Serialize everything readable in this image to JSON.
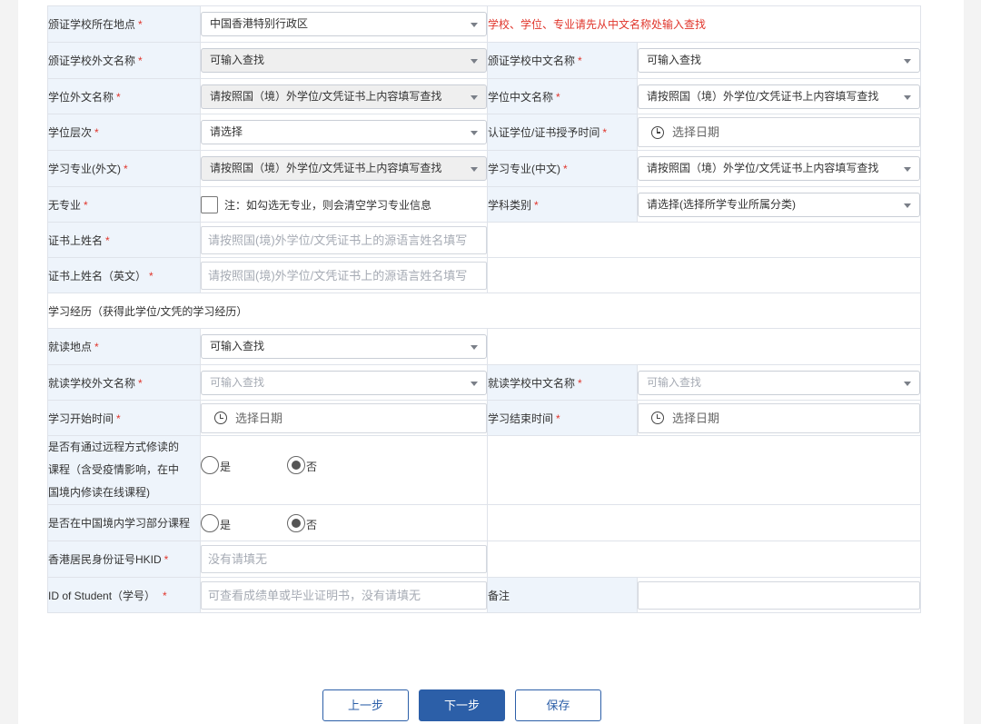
{
  "rows": {
    "school_location": {
      "label": "颁证学校所在地点",
      "value": "中国香港特别行政区",
      "note": "学校、学位、专业请先从中文名称处输入查找"
    },
    "school_foreign": {
      "label": "颁证学校外文名称",
      "value": "可输入查找"
    },
    "school_cn": {
      "label": "颁证学校中文名称",
      "value": "可输入查找"
    },
    "degree_foreign": {
      "label": "学位外文名称",
      "value": "请按照国（境）外学位/文凭证书上内容填写查找"
    },
    "degree_cn": {
      "label": "学位中文名称",
      "value": "请按照国（境）外学位/文凭证书上内容填写查找"
    },
    "degree_level": {
      "label": "学位层次",
      "value": "请选择"
    },
    "award_time": {
      "label": "认证学位/证书授予时间",
      "value": "选择日期"
    },
    "major_foreign": {
      "label": "学习专业(外文)",
      "value": "请按照国（境）外学位/文凭证书上内容填写查找"
    },
    "major_cn": {
      "label": "学习专业(中文)",
      "value": "请按照国（境）外学位/文凭证书上内容填写查找"
    },
    "no_major": {
      "label": "无专业",
      "checkbox_text": "注：如勾选无专业，则会清空学习专业信息"
    },
    "subject_category": {
      "label": "学科类别",
      "value": "请选择(选择所学专业所属分类)"
    },
    "cert_name": {
      "label": "证书上姓名",
      "placeholder": "请按照国(境)外学位/文凭证书上的源语言姓名填写"
    },
    "cert_name_en": {
      "label": "证书上姓名（英文）",
      "placeholder": "请按照国(境)外学位/文凭证书上的源语言姓名填写"
    },
    "study_section": {
      "label": "学习经历（获得此学位/文凭的学习经历）"
    },
    "study_location": {
      "label": "就读地点",
      "value": "可输入查找"
    },
    "study_school_foreign": {
      "label": "就读学校外文名称",
      "value": "可输入查找"
    },
    "study_school_cn": {
      "label": "就读学校中文名称",
      "value": "可输入查找"
    },
    "start_time": {
      "label": "学习开始时间",
      "value": "选择日期"
    },
    "end_time": {
      "label": "学习结束时间",
      "value": "选择日期"
    },
    "remote": {
      "label_lines": [
        "是否有通过远程方式修读的",
        "课程（含受疫情影响，在中",
        "国境内修读在线课程)"
      ],
      "yes": "是",
      "no": "否",
      "selected": "否"
    },
    "in_china": {
      "label": "是否在中国境内学习部分课程",
      "yes": "是",
      "no": "否",
      "selected": "否"
    },
    "hkid": {
      "label": "香港居民身份证号HKID",
      "placeholder": "没有请填无"
    },
    "student_id": {
      "label": "ID of Student（学号）",
      "placeholder": "可查看成绩单或毕业证明书，没有请填无"
    },
    "remarks": {
      "label": "备注",
      "value": ""
    }
  },
  "required_mark": "*",
  "buttons": {
    "prev": "上一步",
    "next": "下一步",
    "save": "保存"
  },
  "colors": {
    "required": "#e0352b",
    "label_bg": "#eef4fb",
    "primary": "#2c5fa8",
    "border": "#dfe3ea"
  }
}
